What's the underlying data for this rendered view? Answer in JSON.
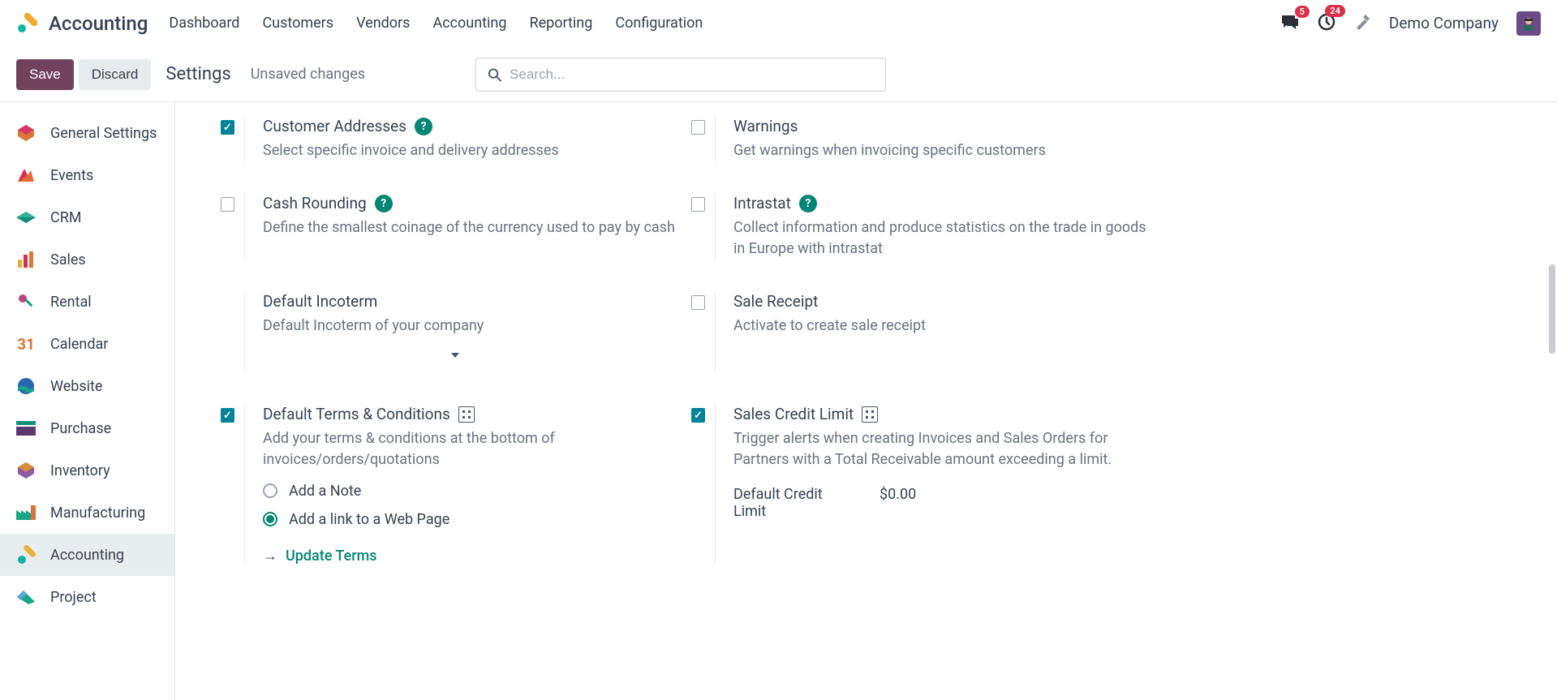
{
  "header": {
    "app": "Accounting",
    "menu": [
      "Dashboard",
      "Customers",
      "Vendors",
      "Accounting",
      "Reporting",
      "Configuration"
    ],
    "messages_badge": "5",
    "activities_badge": "24",
    "company": "Demo Company"
  },
  "controlbar": {
    "save": "Save",
    "discard": "Discard",
    "title": "Settings",
    "status": "Unsaved changes",
    "search_placeholder": "Search..."
  },
  "sidebar": {
    "items": [
      {
        "label": "General Settings"
      },
      {
        "label": "Events"
      },
      {
        "label": "CRM"
      },
      {
        "label": "Sales"
      },
      {
        "label": "Rental"
      },
      {
        "label": "Calendar"
      },
      {
        "label": "Website"
      },
      {
        "label": "Purchase"
      },
      {
        "label": "Inventory"
      },
      {
        "label": "Manufacturing"
      },
      {
        "label": "Accounting"
      },
      {
        "label": "Project"
      }
    ]
  },
  "settings": {
    "customer_addresses": {
      "title": "Customer Addresses",
      "desc": "Select specific invoice and delivery addresses"
    },
    "warnings": {
      "title": "Warnings",
      "desc": "Get warnings when invoicing specific customers"
    },
    "cash_rounding": {
      "title": "Cash Rounding",
      "desc": "Define the smallest coinage of the currency used to pay by cash"
    },
    "intrastat": {
      "title": "Intrastat",
      "desc": "Collect information and produce statistics on the trade in goods in Europe with intrastat"
    },
    "default_incoterm": {
      "title": "Default Incoterm",
      "desc": "Default Incoterm of your company"
    },
    "sale_receipt": {
      "title": "Sale Receipt",
      "desc": "Activate to create sale receipt"
    },
    "default_terms": {
      "title": "Default Terms & Conditions",
      "desc": "Add your terms & conditions at the bottom of invoices/orders/quotations",
      "radio_note": "Add a Note",
      "radio_link": "Add a link to a Web Page",
      "update": "Update Terms"
    },
    "sales_credit_limit": {
      "title": "Sales Credit Limit",
      "desc": "Trigger alerts when creating Invoices and Sales Orders for Partners with a Total Receivable amount exceeding a limit.",
      "field_label": "Default Credit Limit",
      "field_value": "$0.00"
    }
  }
}
